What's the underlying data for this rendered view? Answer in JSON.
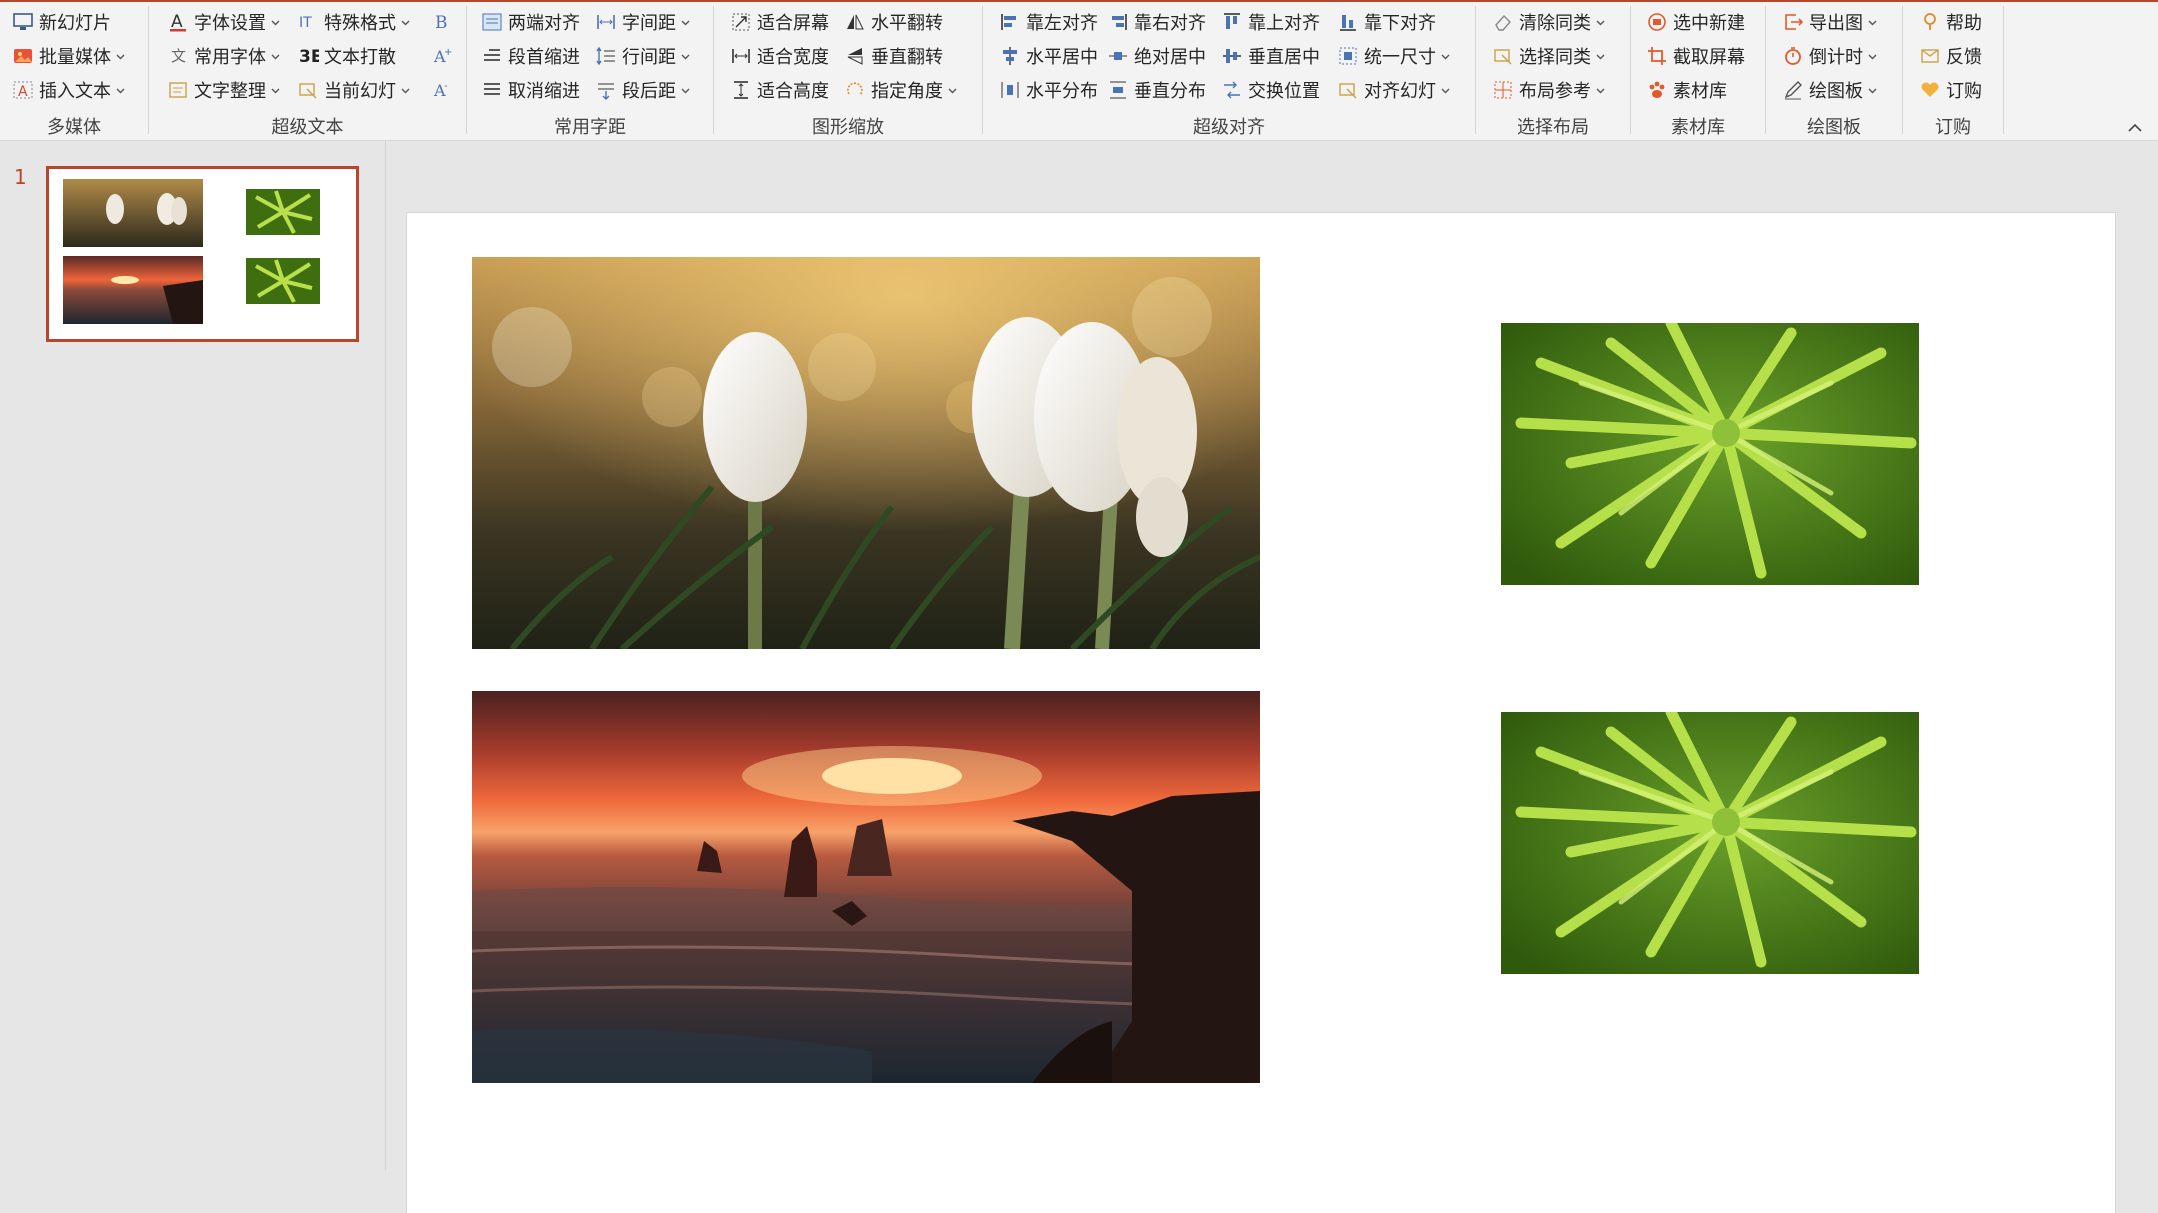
{
  "ribbon": {
    "groups": {
      "media": {
        "label": "多媒体",
        "new_slide": "新幻灯片",
        "batch_media": "批量媒体",
        "insert_text": "插入文本"
      },
      "text": {
        "label": "超级文本",
        "font_settings": "字体设置",
        "common_fonts": "常用字体",
        "text_tidy": "文字整理",
        "special_format": "特殊格式",
        "text_split": "文本打散",
        "current_slide": "当前幻灯"
      },
      "spacing": {
        "label": "常用字距",
        "justify_both": "两端对齐",
        "first_indent": "段首缩进",
        "cancel_indent": "取消缩进",
        "char_spacing": "字间距",
        "line_spacing": "行间距",
        "para_after": "段后距"
      },
      "scale": {
        "label": "图形缩放",
        "fit_screen": "适合屏幕",
        "fit_width": "适合宽度",
        "fit_height": "适合高度",
        "flip_h": "水平翻转",
        "flip_v": "垂直翻转",
        "set_angle": "指定角度"
      },
      "align": {
        "label": "超级对齐",
        "align_left": "靠左对齐",
        "align_right": "靠右对齐",
        "align_top": "靠上对齐",
        "align_bottom": "靠下对齐",
        "h_center": "水平居中",
        "abs_center": "绝对居中",
        "v_center": "垂直居中",
        "same_size": "统一尺寸",
        "h_distribute": "水平分布",
        "v_distribute": "垂直分布",
        "swap_pos": "交换位置",
        "align_slide": "对齐幻灯"
      },
      "layout": {
        "label": "选择布局",
        "clear_same": "清除同类",
        "select_same": "选择同类",
        "layout_ref": "布局参考"
      },
      "material": {
        "label": "素材库",
        "select_new": "选中新建",
        "capture_screen": "截取屏幕",
        "material_lib": "素材库"
      },
      "draw": {
        "label": "绘图板",
        "export_img": "导出图",
        "countdown": "倒计时",
        "drawing_board": "绘图板"
      },
      "order": {
        "label": "订购",
        "help": "帮助",
        "feedback": "反馈",
        "subscribe": "订购"
      }
    }
  },
  "thumbnails": {
    "slide_number": "1"
  },
  "colors": {
    "accent": "#b7472a",
    "ribbon_bg": "#f3f3f3",
    "workspace_bg": "#e6e6e6"
  }
}
